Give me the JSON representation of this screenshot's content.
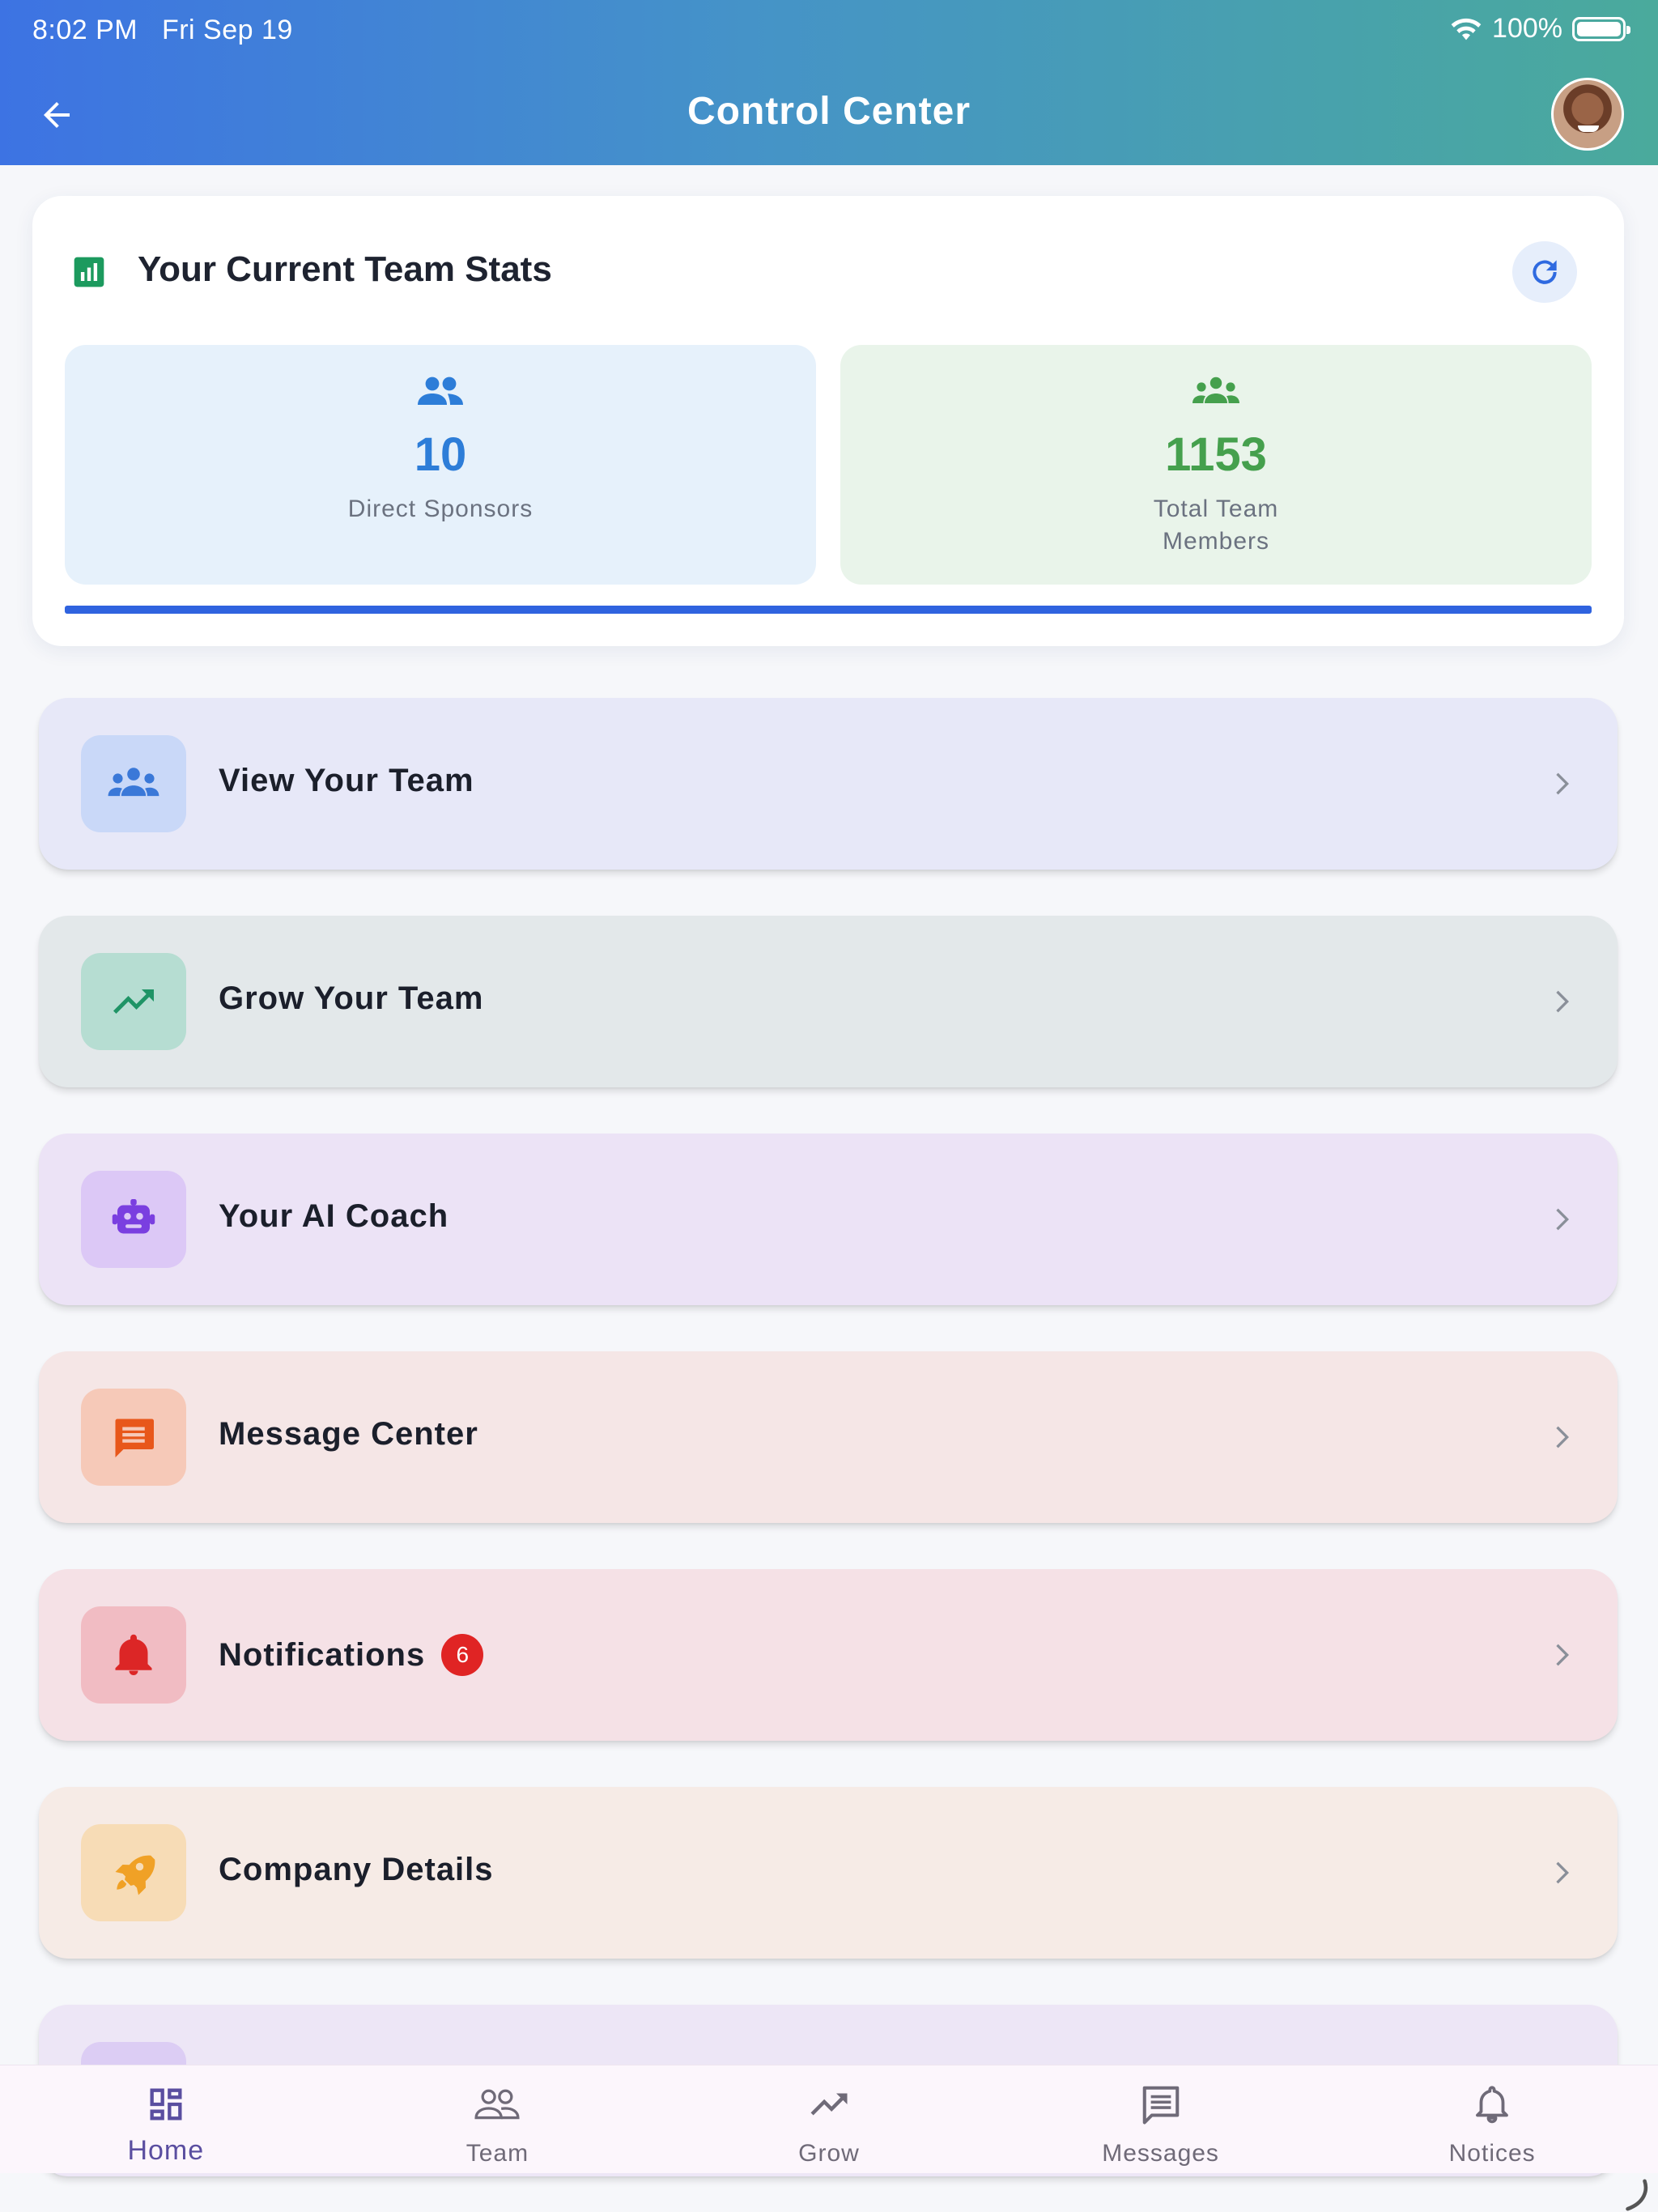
{
  "status_bar": {
    "time": "8:02 PM",
    "date": "Fri Sep 19",
    "battery": "100%"
  },
  "header": {
    "title": "Control Center"
  },
  "stats": {
    "title": "Your Current Team Stats",
    "direct_sponsors": {
      "value": "10",
      "label": "Direct Sponsors"
    },
    "total_team": {
      "value": "1153",
      "label": "Total Team Members"
    }
  },
  "menu": [
    {
      "label": "View Your Team",
      "icon": "team-icon",
      "bg": "#e7e8f8",
      "icon_bg": "#c9d8f8",
      "icon_color": "#3a78d8"
    },
    {
      "label": "Grow Your Team",
      "icon": "trending-up-icon",
      "bg": "#e3e8ea",
      "icon_bg": "#b6ddd2",
      "icon_color": "#1f9466"
    },
    {
      "label": "Your AI Coach",
      "icon": "robot-icon",
      "bg": "#ece3f6",
      "icon_bg": "#dcc8f6",
      "icon_color": "#7a3fe0"
    },
    {
      "label": "Message Center",
      "icon": "message-icon",
      "bg": "#f5e6e6",
      "icon_bg": "#f6c9b8",
      "icon_color": "#e8571a"
    },
    {
      "label": "Notifications",
      "icon": "bell-icon",
      "bg": "#f5e1e6",
      "icon_bg": "#f1bcc3",
      "icon_color": "#dc2626",
      "badge": "6"
    },
    {
      "label": "Company Details",
      "icon": "rocket-icon",
      "bg": "#f6ebe6",
      "icon_bg": "#f7dcb6",
      "icon_color": "#f0a126"
    }
  ],
  "bottom_nav": [
    {
      "label": "Home",
      "icon": "dashboard-icon",
      "active": true
    },
    {
      "label": "Team",
      "icon": "people-icon"
    },
    {
      "label": "Grow",
      "icon": "trending-up-icon"
    },
    {
      "label": "Messages",
      "icon": "message-icon"
    },
    {
      "label": "Notices",
      "icon": "bell-icon"
    }
  ]
}
